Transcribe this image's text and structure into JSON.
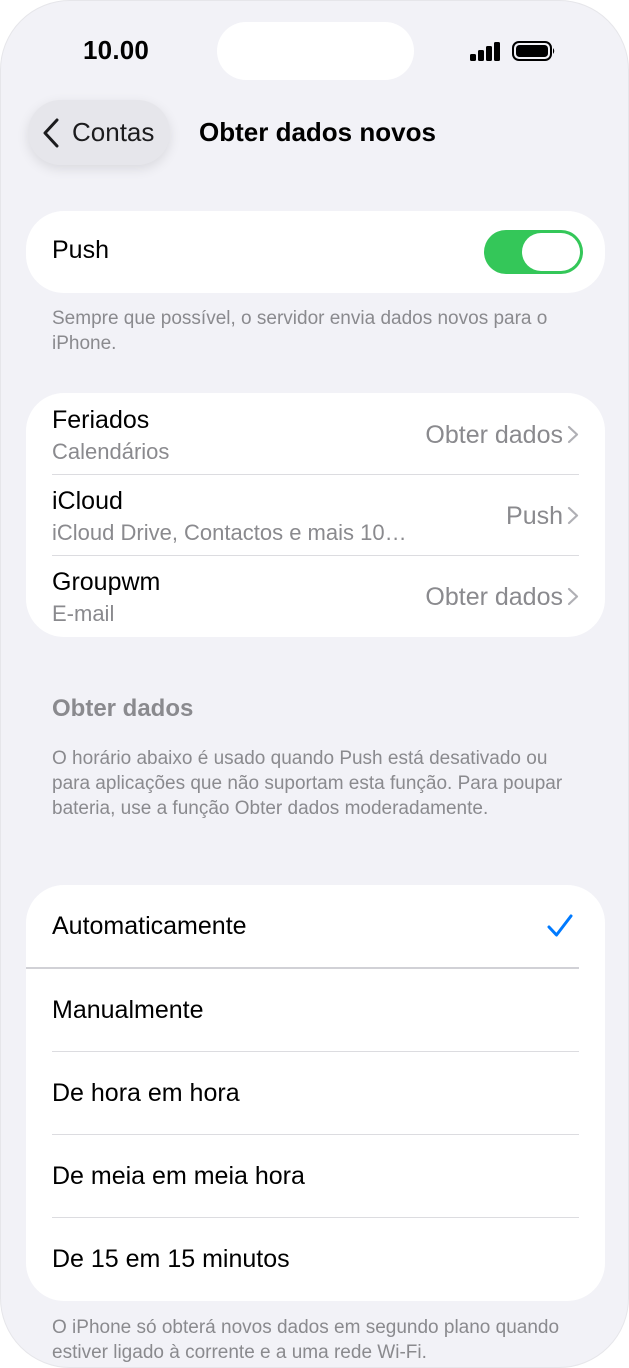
{
  "status_bar": {
    "time": "10.00"
  },
  "nav": {
    "back_label": "Contas",
    "title": "Obter dados novos"
  },
  "push": {
    "label": "Push",
    "enabled": true,
    "footnote": "Sempre que possível, o servidor envia dados novos para o iPhone."
  },
  "accounts": [
    {
      "title": "Feriados",
      "subtitle": "Calendários",
      "value": "Obter dados"
    },
    {
      "title": "iCloud",
      "subtitle": "iCloud Drive, Contactos e mais 10…",
      "value": "Push"
    },
    {
      "title": "Groupwm",
      "subtitle": "E-mail",
      "value": "Obter dados"
    }
  ],
  "fetch_section": {
    "header": "Obter dados",
    "description": "O horário abaixo é usado quando Push está desativado ou para aplicações que não suportam esta função. Para poupar bateria, use a função Obter dados moderadamente.",
    "options": [
      {
        "label": "Automaticamente",
        "selected": true
      },
      {
        "label": "Manualmente",
        "selected": false
      },
      {
        "label": "De hora em hora",
        "selected": false
      },
      {
        "label": "De meia em meia hora",
        "selected": false
      },
      {
        "label": "De 15 em 15 minutos",
        "selected": false
      }
    ],
    "footnote": "O iPhone só obterá novos dados em segundo plano quando estiver ligado à corrente e a uma rede Wi-Fi."
  },
  "colors": {
    "accent": "#007aff",
    "toggle_on": "#34c759",
    "background": "#f2f2f7"
  }
}
